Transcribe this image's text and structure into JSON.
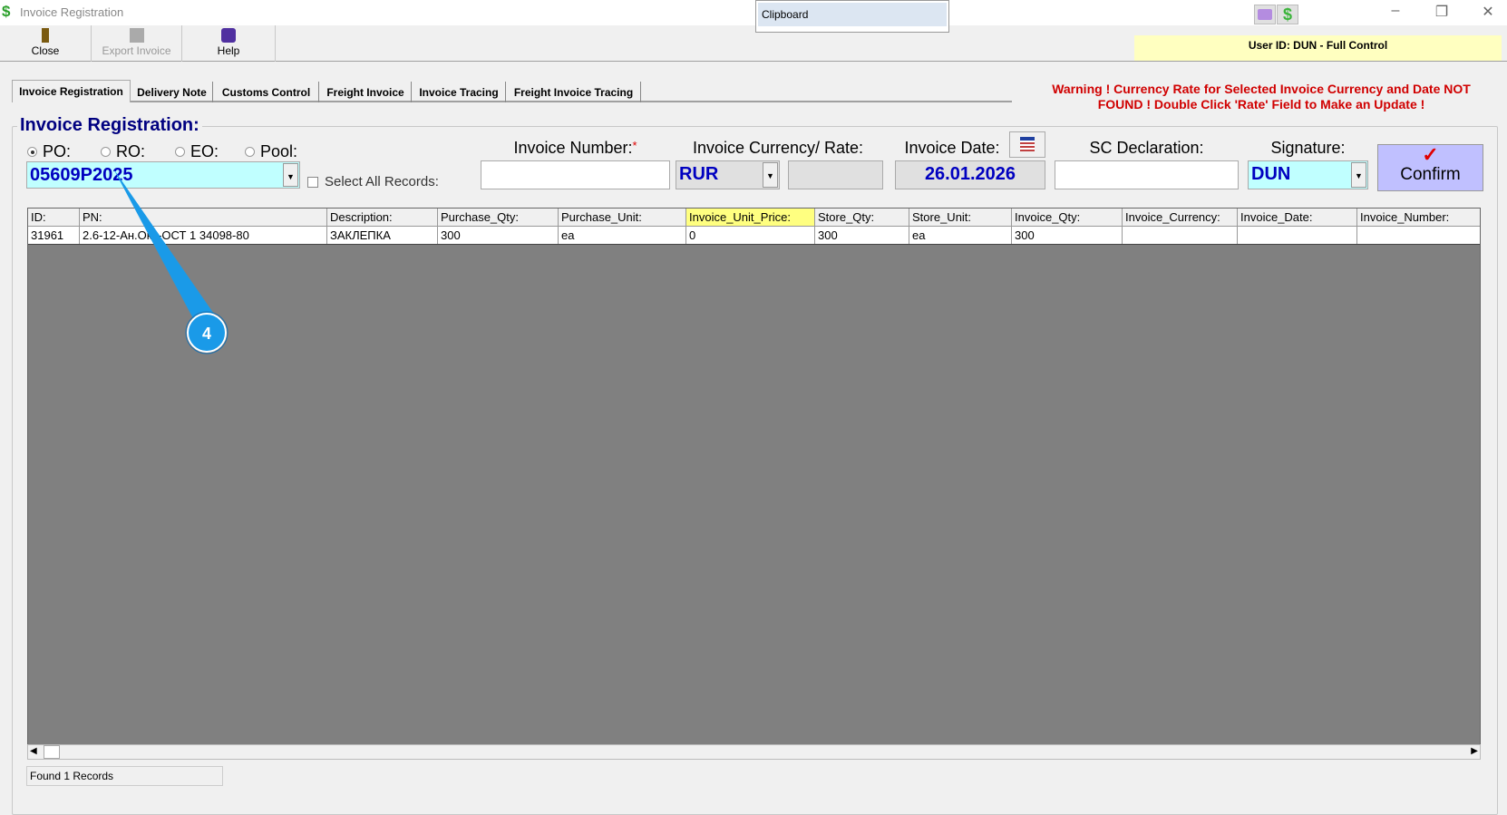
{
  "window": {
    "title": "Invoice Registration",
    "controls": [
      "minimize",
      "restore",
      "close"
    ]
  },
  "clipboard": {
    "label": "Clipboard"
  },
  "toolbar": {
    "close": "Close",
    "export": "Export Invoice",
    "help": "Help"
  },
  "user_info": "User ID: DUN - Full Control",
  "tabs": [
    "Invoice Registration",
    "Delivery Note",
    "Customs Control",
    "Freight Invoice",
    "Invoice Tracing",
    "Freight Invoice Tracing"
  ],
  "warning": {
    "line1": "Warning ! Currency Rate for Selected Invoice Currency and Date NOT",
    "line2": "FOUND ! Double Click 'Rate' Field to Make an Update !"
  },
  "form": {
    "title": "Invoice Registration:",
    "radios": [
      "PO:",
      "RO:",
      "EO:",
      "Pool:"
    ],
    "selected_radio": "PO:",
    "order_value": "05609P2025",
    "select_all_label": "Select All Records:",
    "invoice_number_label": "Invoice Number:",
    "required_mark": "*",
    "invoice_number_value": "",
    "currency_label": "Invoice Currency/ Rate:",
    "currency_value": "RUR",
    "rate_value": "",
    "date_label": "Invoice Date:",
    "date_value": "26.01.2026",
    "sc_label": "SC Declaration:",
    "sc_value": "",
    "signature_label": "Signature:",
    "signature_value": "DUN",
    "confirm_label": "Confirm"
  },
  "table": {
    "columns": [
      "ID:",
      "PN:",
      "Description:",
      "Purchase_Qty:",
      "Purchase_Unit:",
      "Invoice_Unit_Price:",
      "Store_Qty:",
      "Store_Unit:",
      "Invoice_Qty:",
      "Invoice_Currency:",
      "Invoice_Date:",
      "Invoice_Number:"
    ],
    "rows": [
      [
        "31961",
        "2.6-12-Ан.Окс-ОСТ 1 34098-80",
        "ЗАКЛЕПКА",
        "300",
        "ea",
        "0",
        "300",
        "ea",
        "300",
        "",
        "",
        ""
      ]
    ]
  },
  "status": "Found 1 Records",
  "callout": {
    "number": "4"
  },
  "colors": {
    "accent": "#000080",
    "warning": "#d00000",
    "highlight": "#ffff80",
    "callout": "#1a9ae8"
  }
}
